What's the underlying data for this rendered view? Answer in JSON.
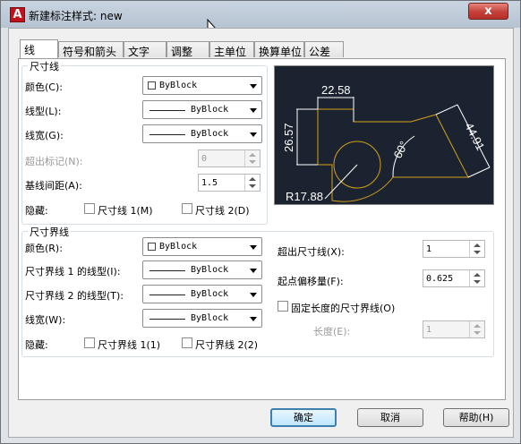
{
  "window": {
    "title": "新建标注样式: new",
    "app_icon_letter": "A",
    "close_glyph": "x"
  },
  "tabs": [
    {
      "label": "线",
      "active": true
    },
    {
      "label": "符号和箭头"
    },
    {
      "label": "文字"
    },
    {
      "label": "调整"
    },
    {
      "label": "主单位"
    },
    {
      "label": "换算单位"
    },
    {
      "label": "公差"
    }
  ],
  "dim_lines": {
    "title": "尺寸线",
    "color_label": "颜色(C):",
    "color_value": "ByBlock",
    "linetype_label": "线型(L):",
    "linetype_value": "ByBlock",
    "lineweight_label": "线宽(G):",
    "lineweight_value": "ByBlock",
    "extend_ticks_label": "超出标记(N):",
    "extend_ticks_value": "0",
    "baseline_spacing_label": "基线间距(A):",
    "baseline_spacing_value": "1.5",
    "suppress_label": "隐藏:",
    "suppress_1": "尺寸线 1(M)",
    "suppress_2": "尺寸线 2(D)"
  },
  "ext_lines": {
    "title": "尺寸界线",
    "color_label": "颜色(R):",
    "color_value": "ByBlock",
    "linetype1_label": "尺寸界线 1 的线型(I):",
    "linetype1_value": "ByBlock",
    "linetype2_label": "尺寸界线 2 的线型(T):",
    "linetype2_value": "ByBlock",
    "lineweight_label": "线宽(W):",
    "lineweight_value": "ByBlock",
    "suppress_label": "隐藏:",
    "suppress_1": "尺寸界线 1(1)",
    "suppress_2": "尺寸界线 2(2)",
    "extend_beyond_label": "超出尺寸线(X):",
    "extend_beyond_value": "1",
    "offset_label": "起点偏移量(F):",
    "offset_value": "0.625",
    "fixed_length_label": "固定长度的尺寸界线(O)",
    "length_label": "长度(E):",
    "length_value": "1"
  },
  "preview": {
    "dim_horizontal": "22.58",
    "dim_vertical": "26.57",
    "dim_aligned": "44.91",
    "dim_angle": "60°",
    "dim_radius": "R17.88"
  },
  "buttons": {
    "ok": "确定",
    "cancel": "取消",
    "help": "帮助(H)"
  },
  "colors": {
    "preview_bg": "#1c2330",
    "preview_geometry": "#d4a017",
    "preview_dims": "#ffffff",
    "close_red": "#c4413a"
  }
}
